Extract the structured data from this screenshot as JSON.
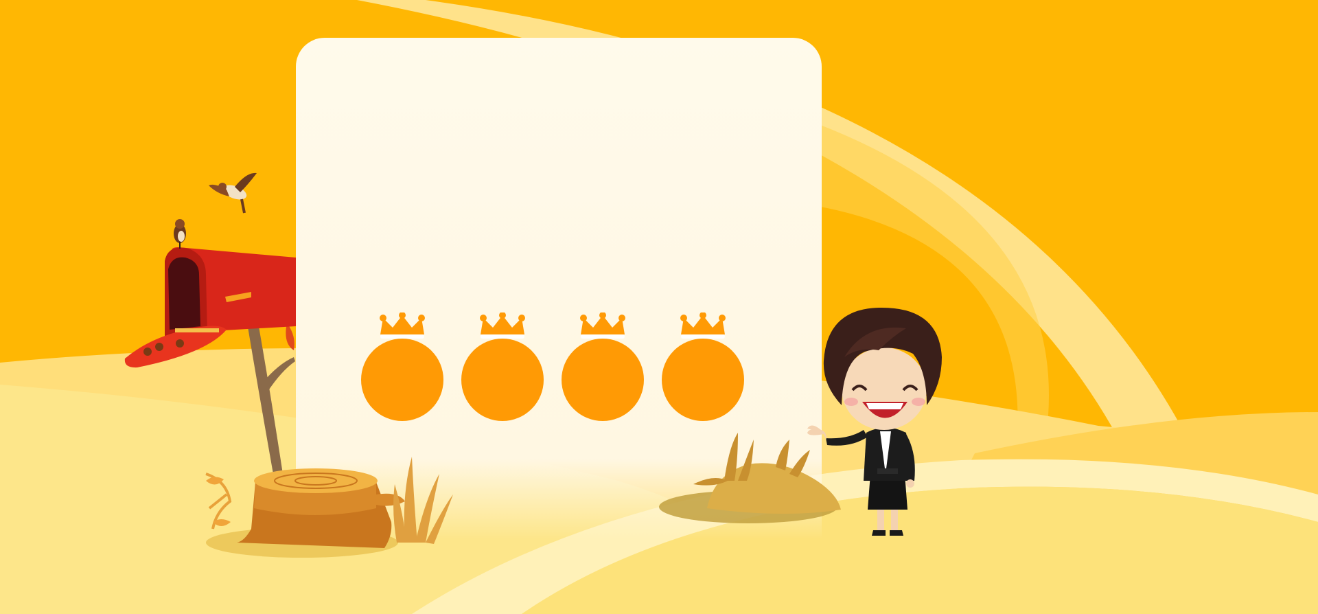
{
  "banner": {
    "title_placeholder_chars": [
      "",
      "",
      "",
      ""
    ]
  },
  "colors": {
    "background": "#ffb703",
    "panel": "#fff8e6",
    "badge": "#ff9a05",
    "crown": "#ff9a05",
    "mailbox": "#e52a1c",
    "ground": "#fde68a"
  },
  "icons": [
    "crown-icon",
    "mailbox",
    "bird",
    "tree-stump",
    "dry-grass",
    "rock",
    "cartoon-businesswoman"
  ]
}
